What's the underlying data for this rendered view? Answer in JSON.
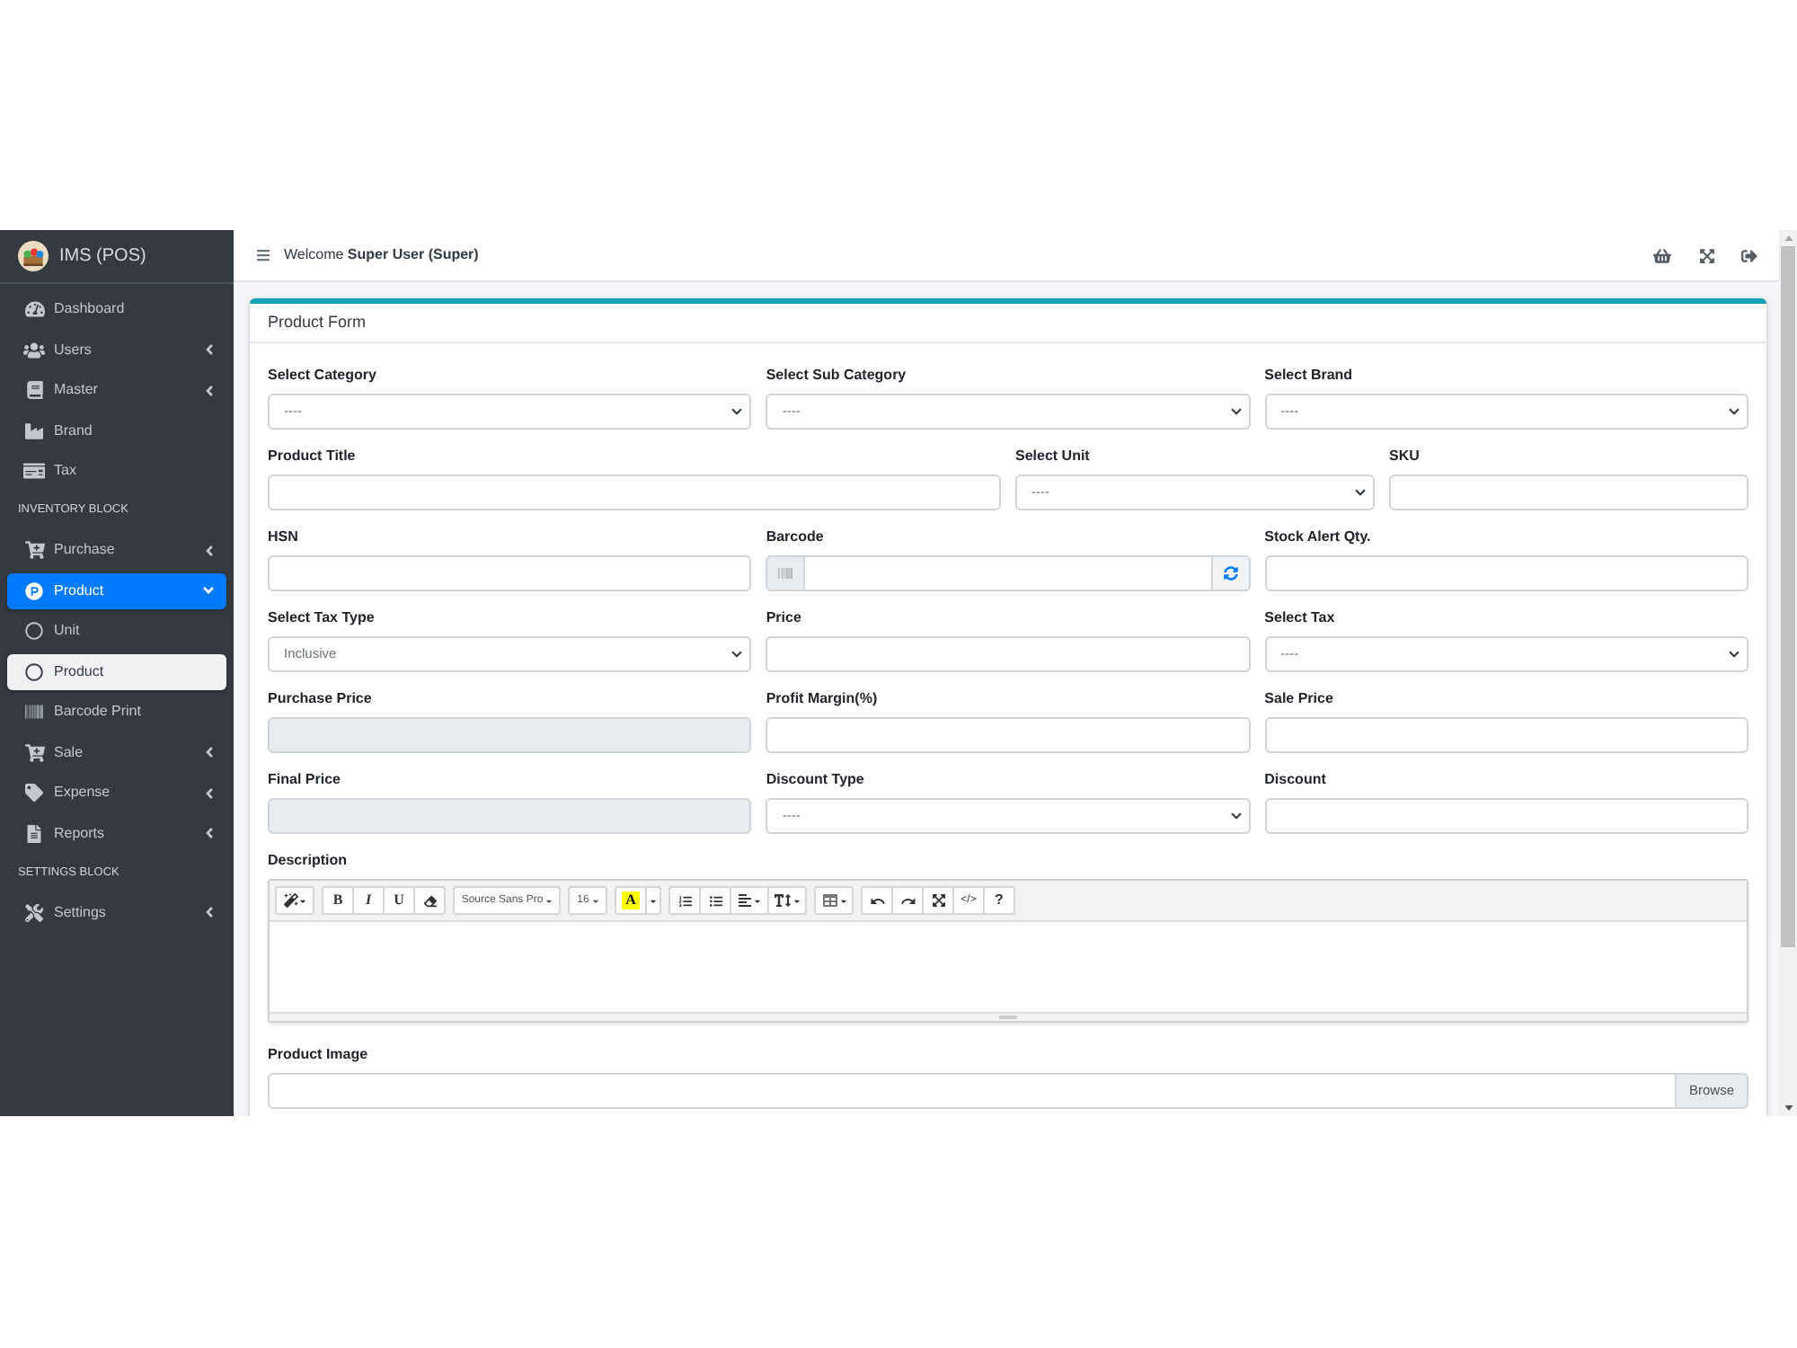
{
  "sidebar": {
    "brand": "IMS (POS)",
    "items": [
      {
        "kind": "link",
        "label": "Dashboard",
        "selected": false
      },
      {
        "kind": "menu",
        "label": "Users",
        "selected": false,
        "expanded": false
      },
      {
        "kind": "menu",
        "label": "Master",
        "selected": false,
        "expanded": false
      },
      {
        "kind": "link",
        "label": "Brand",
        "selected": false
      },
      {
        "kind": "link",
        "label": "Tax",
        "selected": false
      },
      {
        "kind": "header",
        "label": "INVENTORY BLOCK"
      },
      {
        "kind": "menu",
        "label": "Purchase",
        "selected": false,
        "expanded": false
      },
      {
        "kind": "menu",
        "label": "Product",
        "selected": true,
        "expanded": true,
        "children": [
          {
            "label": "Unit",
            "selected": false
          },
          {
            "label": "Product",
            "selected": true
          }
        ]
      },
      {
        "kind": "link",
        "label": "Barcode Print",
        "selected": false
      },
      {
        "kind": "menu",
        "label": "Sale",
        "selected": false,
        "expanded": false
      },
      {
        "kind": "menu",
        "label": "Expense",
        "selected": false,
        "expanded": false
      },
      {
        "kind": "menu",
        "label": "Reports",
        "selected": false,
        "expanded": false
      },
      {
        "kind": "header",
        "label": "SETTINGS BLOCK"
      },
      {
        "kind": "menu",
        "label": "Settings",
        "selected": false,
        "expanded": false
      }
    ]
  },
  "header": {
    "welcome": "Welcome **Super User (Super)**"
  },
  "form": {
    "title": "Product Form",
    "rows": [
      {
        "fields": [
          {
            "label": "Select Category",
            "kind": "select",
            "value": "----",
            "disabled": false
          },
          {
            "label": "Select Sub Category",
            "kind": "select",
            "value": "----",
            "disabled": false
          },
          {
            "label": "Select Brand",
            "kind": "select",
            "value": "----",
            "disabled": false
          }
        ]
      },
      {
        "fields": [
          {
            "label": "Product Title",
            "kind": "text",
            "disabled": false
          },
          {
            "label": "Select Unit",
            "kind": "select",
            "value": "----",
            "disabled": false
          },
          {
            "label": "SKU",
            "kind": "text",
            "disabled": false
          }
        ]
      },
      {
        "fields": [
          {
            "label": "HSN",
            "kind": "text",
            "disabled": false
          },
          {
            "label": "Barcode",
            "kind": "barcode",
            "disabled": false
          },
          {
            "label": "Stock Alert Qty.",
            "kind": "text",
            "disabled": false
          }
        ]
      },
      {
        "fields": [
          {
            "label": "Select Tax Type",
            "kind": "select",
            "value": "Inclusive",
            "disabled": false
          },
          {
            "label": "Price",
            "kind": "text",
            "disabled": false
          },
          {
            "label": "Select Tax",
            "kind": "select",
            "value": "----",
            "disabled": false
          }
        ]
      },
      {
        "fields": [
          {
            "label": "Purchase Price",
            "kind": "text",
            "disabled": true
          },
          {
            "label": "Profit Margin(%)",
            "kind": "text",
            "disabled": false
          },
          {
            "label": "Sale Price",
            "kind": "text",
            "disabled": false
          }
        ]
      },
      {
        "fields": [
          {
            "label": "Final Price",
            "kind": "text",
            "disabled": true
          },
          {
            "label": "Discount Type",
            "kind": "select",
            "value": "----",
            "disabled": false
          },
          {
            "label": "Discount",
            "kind": "text",
            "disabled": false
          }
        ]
      }
    ],
    "editor": {
      "label": "Description",
      "toolbar": {
        "bold": "B",
        "italic": "I",
        "underline": "U",
        "font": "Source Sans Pro",
        "size": "16",
        "font_color": "A",
        "code": "</>",
        "help": "?"
      }
    },
    "image": {
      "label": "Product Image",
      "button": "Browse"
    }
  }
}
